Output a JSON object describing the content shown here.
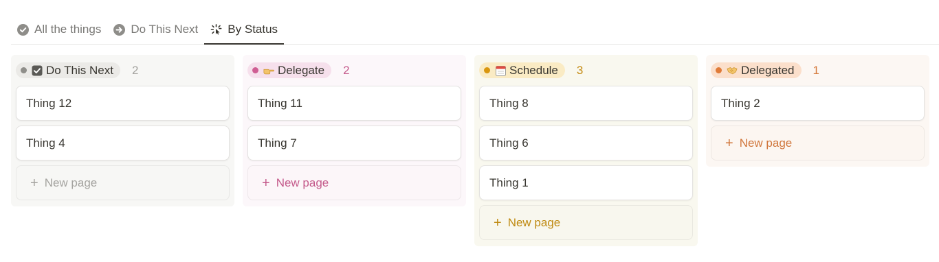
{
  "tabs": [
    {
      "label": "All the things",
      "icon": "check-circle-icon",
      "active": false
    },
    {
      "label": "Do This Next",
      "icon": "arrow-circle-right-icon",
      "active": false
    },
    {
      "label": "By Status",
      "icon": "loading-sparkle-icon",
      "active": true
    }
  ],
  "columns": [
    {
      "title": "Do This Next",
      "emoji": "checkbox-icon",
      "count": "2",
      "colors": {
        "bg": "#f7f7f5",
        "pill": "#ebeae7",
        "dot": "#8f8e8a",
        "count": "#a4a39f",
        "new": "#a4a39f",
        "newbg": "#f7f7f5"
      },
      "cards": [
        "Thing 12",
        "Thing 4"
      ],
      "new_page_label": "New page"
    },
    {
      "title": "Delegate",
      "emoji": "pointing-hand-icon",
      "count": "2",
      "colors": {
        "bg": "#fcf7fa",
        "pill": "#f6e0ec",
        "dot": "#cf5e93",
        "count": "#c45a8b",
        "new": "#c45a8b",
        "newbg": "#fcf6f9"
      },
      "cards": [
        "Thing 11",
        "Thing 7"
      ],
      "new_page_label": "New page"
    },
    {
      "title": "Schedule",
      "emoji": "calendar-icon",
      "count": "3",
      "colors": {
        "bg": "#f9f8ef",
        "pill": "#faebc4",
        "dot": "#d9960f",
        "count": "#c48a10",
        "new": "#bf8a12",
        "newbg": "#f8f7ee"
      },
      "cards": [
        "Thing 8",
        "Thing 6",
        "Thing 1"
      ],
      "new_page_label": "New page"
    },
    {
      "title": "Delegated",
      "emoji": "handshake-icon",
      "count": "1",
      "colors": {
        "bg": "#fcf7f3",
        "pill": "#fbdfcb",
        "dot": "#e07b39",
        "count": "#d57a3c",
        "new": "#d0753a",
        "newbg": "#fcf6f1"
      },
      "cards": [
        "Thing 2"
      ],
      "new_page_label": "New page"
    }
  ]
}
